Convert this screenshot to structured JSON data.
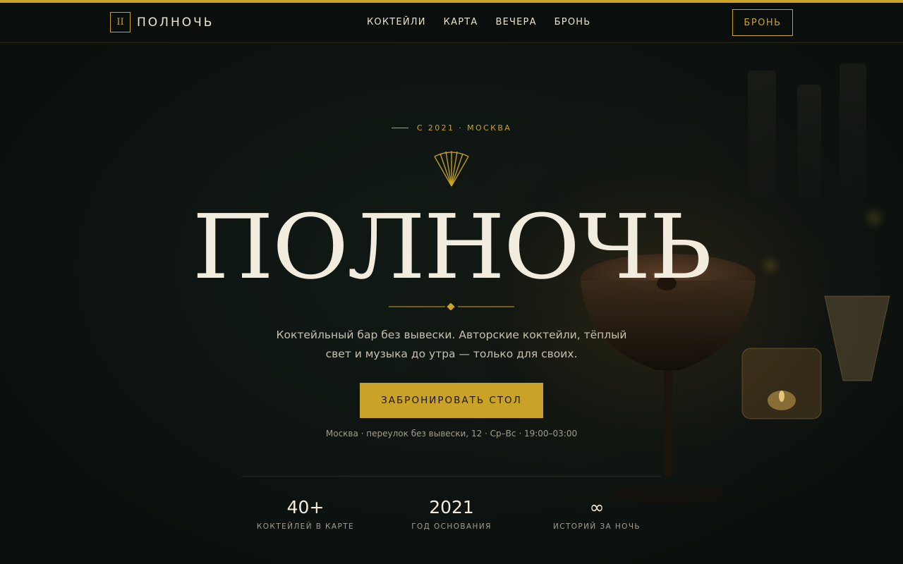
{
  "header": {
    "logo_mark": "II",
    "logo_text": "ПОЛНОЧЬ",
    "nav": [
      "КОКТЕЙЛИ",
      "КАРТА",
      "ВЕЧЕРА",
      "БРОНЬ"
    ],
    "book_button": "БРОНЬ"
  },
  "hero": {
    "eyebrow": "С 2021 · МОСКВА",
    "title": "ПОЛНОЧЬ",
    "tagline": "Коктейльный бар без вывески. Авторские коктейли, тёплый свет и музыка до утра — только для своих.",
    "cta": "ЗАБРОНИРОВАТЬ СТОЛ",
    "address": "Москва · переулок без вывески, 12 · Ср–Вс · 19:00–03:00"
  },
  "stats": [
    {
      "value": "40+",
      "label": "КОКТЕЙЛЕЙ В КАРТЕ"
    },
    {
      "value": "2021",
      "label": "ГОД ОСНОВАНИЯ"
    },
    {
      "value": "∞",
      "label": "ИСТОРИЙ ЗА НОЧЬ"
    }
  ],
  "colors": {
    "accent": "#c9a227",
    "background": "#0c1210",
    "text": "#f2ecdf"
  }
}
